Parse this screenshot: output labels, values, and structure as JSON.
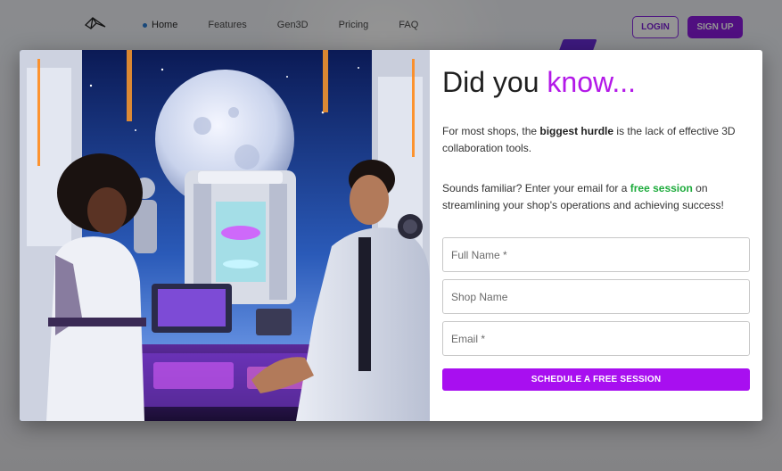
{
  "navbar": {
    "logo_icon": "wireframe-bird-logo",
    "links": [
      {
        "label": "Home",
        "active": true
      },
      {
        "label": "Features",
        "active": false
      },
      {
        "label": "Gen3D",
        "active": false
      },
      {
        "label": "Pricing",
        "active": false
      },
      {
        "label": "FAQ",
        "active": false
      }
    ],
    "login_label": "LOGIN",
    "signup_label": "SIGN UP"
  },
  "modal": {
    "image_icon": "sci-fi-lab-illustration",
    "title_part1": "Did you ",
    "title_part2": "know...",
    "para1_pre": "For most shops, the ",
    "para1_bold": "biggest hurdle",
    "para1_post": " is the lack of effective 3D collaboration tools.",
    "para2_pre": "Sounds familiar? Enter your email for a ",
    "para2_highlight": "free session",
    "para2_post": " on streamlining your shop's operations and achieving success!",
    "form": {
      "full_name_placeholder": "Full Name *",
      "shop_name_placeholder": "Shop Name",
      "email_placeholder": "Email *",
      "submit_label": "SCHEDULE A FREE SESSION"
    }
  },
  "colors": {
    "accent_purple": "#b318e8",
    "button_purple": "#a80ff0",
    "highlight_green": "#1dab3c"
  }
}
